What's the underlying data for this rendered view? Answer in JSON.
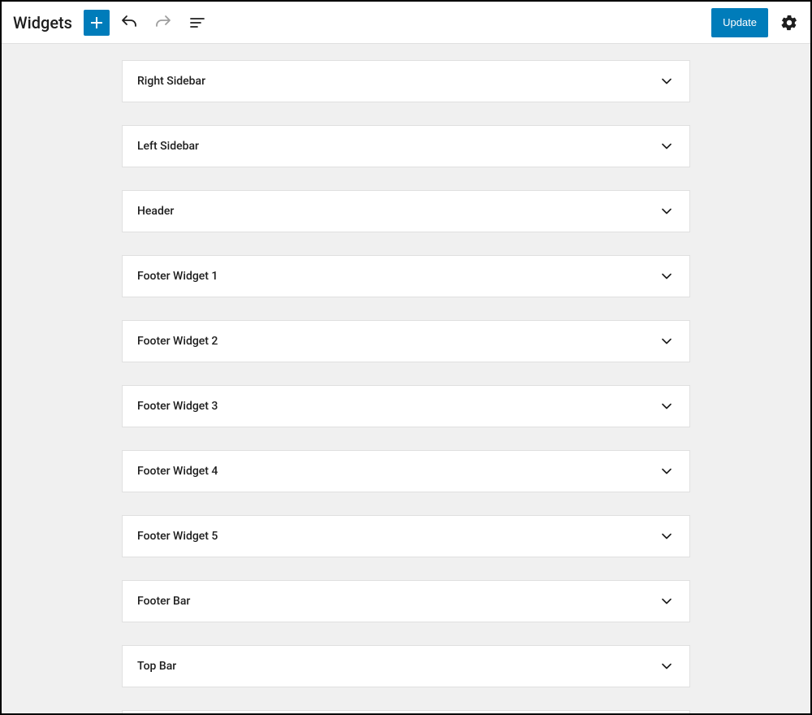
{
  "header": {
    "title": "Widgets",
    "update_label": "Update"
  },
  "widget_areas": [
    {
      "title": "Right Sidebar"
    },
    {
      "title": "Left Sidebar"
    },
    {
      "title": "Header"
    },
    {
      "title": "Footer Widget 1"
    },
    {
      "title": "Footer Widget 2"
    },
    {
      "title": "Footer Widget 3"
    },
    {
      "title": "Footer Widget 4"
    },
    {
      "title": "Footer Widget 5"
    },
    {
      "title": "Footer Bar"
    },
    {
      "title": "Top Bar"
    }
  ]
}
